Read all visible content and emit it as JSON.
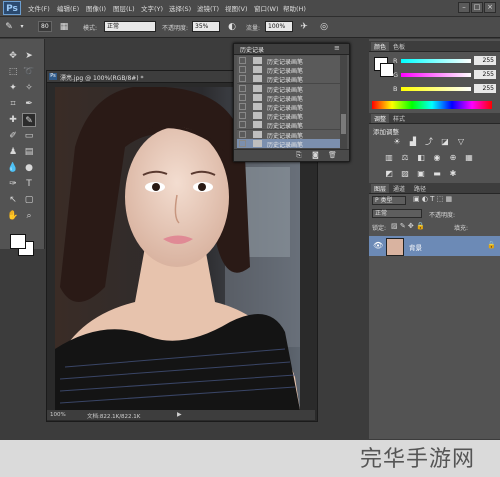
{
  "app": {
    "logo": "Ps"
  },
  "menu": {
    "items": [
      "文件(F)",
      "编辑(E)",
      "图像(I)",
      "图层(L)",
      "文字(Y)",
      "选择(S)",
      "滤镜(T)",
      "视图(V)",
      "窗口(W)",
      "帮助(H)"
    ]
  },
  "window_controls": {
    "minimize": "–",
    "maximize": "□",
    "close": "×"
  },
  "options": {
    "brush_size": "80",
    "mode_label": "模式:",
    "mode_value": "正常",
    "opacity_label": "不透明度:",
    "opacity_value": "35%",
    "flow_label": "流量:",
    "flow_value": "100%"
  },
  "document": {
    "tab_icon": "Ps",
    "tab_title": "漂亮.jpg @ 100%(RGB/8#) *",
    "zoom": "100%",
    "doc_size": "文档:822.1K/822.1K"
  },
  "history": {
    "title": "历史记录",
    "items": [
      {
        "label": "历史记录画笔",
        "selected": false
      },
      {
        "label": "历史记录画笔",
        "selected": false
      },
      {
        "label": "历史记录画笔",
        "selected": false
      },
      {
        "label": "历史记录画笔",
        "selected": false
      },
      {
        "label": "历史记录画笔",
        "selected": false
      },
      {
        "label": "历史记录画笔",
        "selected": false
      },
      {
        "label": "历史记录画笔",
        "selected": false
      },
      {
        "label": "历史记录画笔",
        "selected": false
      },
      {
        "label": "历史记录画笔",
        "selected": false
      },
      {
        "label": "历史记录画笔",
        "selected": true
      }
    ]
  },
  "color_panel": {
    "tab_color": "颜色",
    "tab_swatches": "色板",
    "r_label": "R",
    "r_value": "255",
    "g_label": "G",
    "g_value": "255",
    "b_label": "B",
    "b_value": "255"
  },
  "adjust_panel": {
    "tab_adjust": "调整",
    "tab_styles": "样式",
    "title": "添加调整"
  },
  "layers_panel": {
    "tab_layers": "图层",
    "tab_channels": "通道",
    "tab_paths": "路径",
    "kind_value": "P 类型",
    "blend_mode": "正常",
    "opacity_label": "不透明度:",
    "lock_label": "锁定:",
    "fill_label": "填充:",
    "layer_name": "背景"
  },
  "watermark": {
    "text": "完华手游网"
  }
}
